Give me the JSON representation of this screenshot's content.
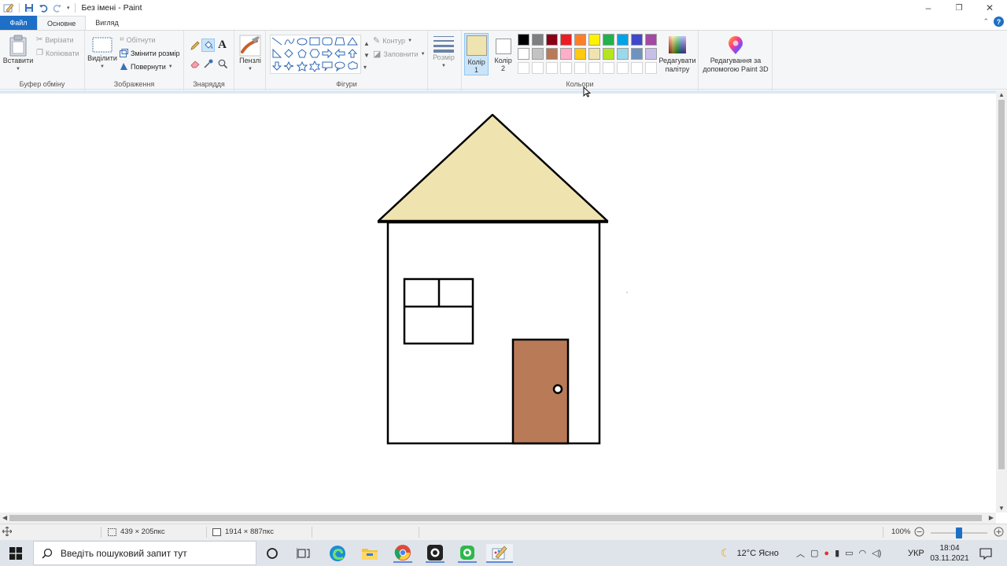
{
  "window": {
    "title": "Без імені - Paint",
    "minimize": "–",
    "restore": "❐",
    "close": "✕"
  },
  "tabs": {
    "file": "Файл",
    "home": "Основне",
    "view": "Вигляд",
    "help": "?"
  },
  "ribbon": {
    "clipboard": {
      "label": "Буфер обміну",
      "paste": "Вставити",
      "cut": "Вирізати",
      "copy": "Копіювати"
    },
    "image": {
      "label": "Зображення",
      "select": "Виділити",
      "crop": "Обітнути",
      "resize": "Змінити розмір",
      "rotate": "Повернути"
    },
    "tools": {
      "label": "Знаряддя"
    },
    "brushes": {
      "label": "Пензлі"
    },
    "shapes": {
      "label": "Фігури",
      "outline": "Контур",
      "fill": "Заповнити"
    },
    "size": {
      "label": "Розмір"
    },
    "colors": {
      "label": "Кольори",
      "color1": "Колір 1",
      "color2": "Колір 2",
      "color1_value": "#efe4b0",
      "color2_value": "#ffffff",
      "edit": "Редагувати палітру",
      "paint3d": "Редагування за допомогою Paint 3D",
      "palette_row1": [
        "#000000",
        "#7f7f7f",
        "#880015",
        "#ed1c24",
        "#ff7f27",
        "#fff200",
        "#22b14c",
        "#00a2e8",
        "#3f48cc",
        "#a349a4"
      ],
      "palette_row2": [
        "#ffffff",
        "#c3c3c3",
        "#b97a57",
        "#ffaec9",
        "#ffc90e",
        "#efe4b0",
        "#b5e61d",
        "#99d9ea",
        "#7092be",
        "#c8bfe7"
      ]
    }
  },
  "drawing": {
    "roof_color": "#efe4b0",
    "door_color": "#b97a57",
    "outline_color": "#000000"
  },
  "status": {
    "selection_size": "439 × 205пкс",
    "canvas_size": "1914 × 887пкс",
    "zoom": "100%",
    "zoom_level": 0.5
  },
  "taskbar": {
    "search_placeholder": "Введіть пошуковий запит тут",
    "weather": "12°C  Ясно",
    "language": "УКР",
    "time": "18:04",
    "date": "03.11.2021"
  }
}
